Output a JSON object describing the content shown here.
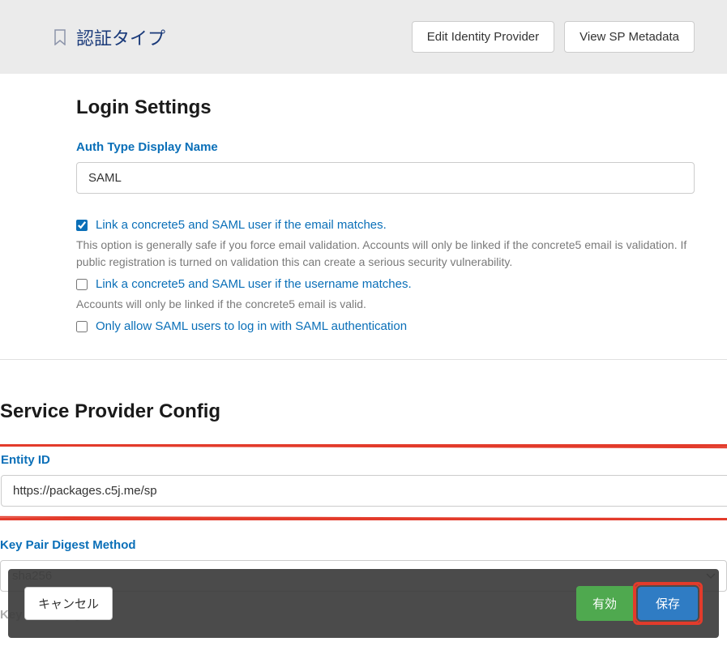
{
  "header": {
    "title": "認証タイプ",
    "edit_idp_label": "Edit Identity Provider",
    "view_sp_label": "View SP Metadata"
  },
  "login_settings": {
    "section_title": "Login Settings",
    "display_name_label": "Auth Type Display Name",
    "display_name_value": "SAML",
    "link_email": {
      "checked": true,
      "label": "Link a concrete5 and SAML user if the email matches.",
      "help": "This option is generally safe if you force email validation. Accounts will only be linked if the concrete5 email is validation. If public registration is turned on validation this can create a serious security vulnerability."
    },
    "link_username": {
      "checked": false,
      "label": "Link a concrete5 and SAML user if the username matches.",
      "help": "Accounts will only be linked if the concrete5 email is valid."
    },
    "only_saml": {
      "checked": false,
      "label": "Only allow SAML users to log in with SAML authentication"
    }
  },
  "sp_config": {
    "section_title": "Service Provider Config",
    "entity_id_label": "Entity ID",
    "entity_id_value": "https://packages.c5j.me/sp",
    "digest_label": "Key Pair Digest Method",
    "digest_value": "sha256",
    "length_label": "Key Pair Length"
  },
  "footer": {
    "cancel": "キャンセル",
    "enable": "有効",
    "save": "保存"
  }
}
